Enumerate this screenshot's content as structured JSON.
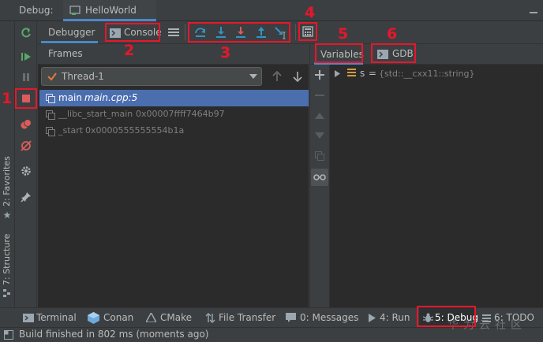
{
  "header": {
    "debug_label": "Debug:",
    "run_config": "HelloWorld"
  },
  "left_strip": {
    "favorites": "2: Favorites",
    "structure": "7: Structure"
  },
  "toolbar": {
    "debugger_tab": "Debugger",
    "console_tab": "Console",
    "step_actions": [
      "step-over-icon",
      "step-into-icon",
      "force-step-into-icon",
      "step-out-icon",
      "run-to-cursor-icon"
    ],
    "evaluate_icon": "calculator-icon"
  },
  "frames": {
    "title": "Frames",
    "thread": "Thread-1",
    "items": [
      {
        "name": "main",
        "location": "main.cpp:5"
      },
      {
        "name": "__libc_start_main",
        "location": "0x00007ffff7464b97"
      },
      {
        "name": "_start",
        "location": "0x0000555555554b1a"
      }
    ]
  },
  "variables": {
    "tab": "Variables",
    "gdb_tab": "GDB",
    "items": [
      {
        "name": "s",
        "eq": " = ",
        "value": "{std::__cxx11::string}"
      }
    ]
  },
  "annotations": [
    "1",
    "2",
    "3",
    "4",
    "5",
    "6"
  ],
  "bottom_bar": {
    "terminal": "Terminal",
    "conan": "Conan",
    "cmake": "CMake",
    "file_transfer": "File Transfer",
    "messages": "0: Messages",
    "run": "4: Run",
    "debug": "5: Debug",
    "todo": "6: TODO"
  },
  "status": {
    "text": "Build finished in 802 ms (moments ago)"
  },
  "watermark": "华为云社区",
  "colors": {
    "accent": "#4a88c7",
    "selection": "#4b6eaf",
    "annotation": "#e8162b",
    "run_green": "#59a869",
    "stop_red": "#db5c5c"
  }
}
